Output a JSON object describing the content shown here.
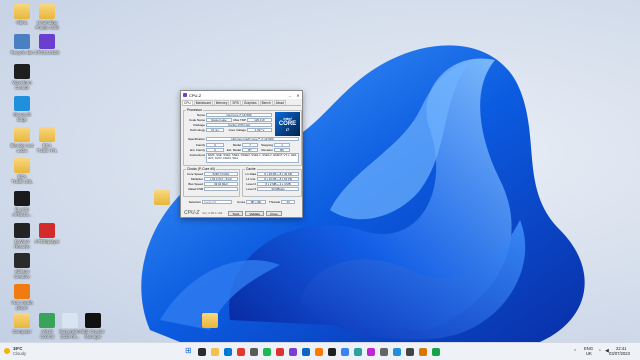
{
  "desktop_icons": [
    {
      "label": "HEAL",
      "color": "#f2c14e",
      "kind": "folder"
    },
    {
      "label": "Unwinding\nProtein Grid",
      "color": "#f2c14e",
      "kind": "folder"
    },
    {
      "label": "Recycle Bin",
      "color": "#4a7fc1",
      "kind": "bin"
    },
    {
      "label": "CRSOUNDS",
      "color": "#6a3fd0",
      "kind": "app"
    },
    {
      "label": "Waveform\nCreator",
      "color": "#1f1f1f",
      "kind": "app"
    },
    {
      "label": "Microsoft\nEdge",
      "color": "#1f8fde",
      "kind": "app"
    },
    {
      "label": "Blender test\naudio",
      "color": "#f2c14e",
      "kind": "folder"
    },
    {
      "label": "BCA\nTUBE HFL",
      "color": "#f2c14e",
      "kind": "folder"
    },
    {
      "label": "BCA\nTUBE UDL",
      "color": "#f2c14e",
      "kind": "folder"
    },
    {
      "label": "BLACK\nAIRBUS...",
      "color": "#1b1b1b",
      "kind": "app"
    },
    {
      "label": "DaVinci\nResolve",
      "color": "#232323",
      "kind": "app"
    },
    {
      "label": "AITEMplayer",
      "color": "#d42a2a",
      "kind": "app"
    },
    {
      "label": "Ableton\nCreative",
      "color": "#2b2b2b",
      "kind": "app"
    },
    {
      "label": "VLC media\nplayer",
      "color": "#f07b10",
      "kind": "app"
    },
    {
      "label": "Computer",
      "color": "#f2c14e",
      "kind": "folder"
    },
    {
      "label": "ASUS\nControl",
      "color": "#3aa35a",
      "kind": "app"
    },
    {
      "label": "Screenshot\n2023-09...",
      "color": "#d9e4f2",
      "kind": "file"
    },
    {
      "label": "Edit Creator\nManager",
      "color": "#111111",
      "kind": "app"
    },
    {
      "label": "",
      "color": "#f2c14e",
      "kind": "folder"
    },
    {
      "label": "",
      "color": "#f2c14e",
      "kind": "folder"
    }
  ],
  "cpuz": {
    "title": "CPU-Z",
    "tabs": [
      "CPU",
      "Mainboard",
      "Memory",
      "SPD",
      "Graphics",
      "Bench",
      "About"
    ],
    "processor_group": "Processor",
    "name_label": "Name",
    "name": "Intel Core i7 13700K",
    "codename_label": "Code Name",
    "codename": "Raptor Lake",
    "maxtdp_label": "Max TDP",
    "maxtdp": "125.0 W",
    "package_label": "Package",
    "package": "Socket 1700 LGA",
    "technology_label": "Technology",
    "technology": "10 nm",
    "corevoltage_label": "Core Voltage",
    "corevoltage": "1.337 V",
    "spec_label": "Specification",
    "spec": "13th Gen Intel® Core™ i7-13700K",
    "family_label": "Family",
    "family": "6",
    "model_label": "Model",
    "model": "7",
    "stepping_label": "Stepping",
    "stepping": "1",
    "extfamily_label": "Ext. Family",
    "extfamily": "6",
    "extmodel_label": "Ext. Model",
    "extmodel": "B7",
    "revision_label": "Revision",
    "revision": "B0",
    "instr_label": "Instructions",
    "instructions": "MMX, SSE, SSE2, SSE3, SSSE3, SSE4.1, SSE4.2, EM64T, VT-x, AES, AVX, AVX2, FMA3, SHA",
    "clocks_group": "Clocks (P-Core #0)",
    "corespeed_label": "Core Speed",
    "corespeed": "5296.73 MHz",
    "multiplier_label": "Multiplier",
    "multiplier": "x 53.0 (8.0 - 53.0)",
    "busspeed_label": "Bus Speed",
    "busspeed": "99.94 MHz",
    "ratedfsb_label": "Rated FSB",
    "ratedfsb": "",
    "cache_group": "Cache",
    "l1d_label": "L1 Data",
    "l1d": "8 x 48 KB + 8 x 32 KB",
    "l1i_label": "L1 Inst.",
    "l1i": "8 x 32 KB + 8 x 64 KB",
    "l2_label": "Level 2",
    "l2": "8 x 2 MB + 2 x 4 MB",
    "l3_label": "Level 3",
    "l3": "30 MBytes",
    "selection_label": "Selection",
    "selection": "Socket #1",
    "cores_label": "Cores",
    "cores": "8P + 8E",
    "threads_label": "Threads",
    "threads": "24",
    "brand": "CPU-Z",
    "version": "Ver. 2.05.1.x64",
    "tools_btn": "Tools",
    "validate_btn": "Validate",
    "close_btn": "Close",
    "intel_brand": "intel",
    "intel_core": "CORE",
    "intel_tier": "i7"
  },
  "taskbar": {
    "weather_temp": "19°C",
    "weather_text": "Cloudy",
    "lang_top": "ENG",
    "lang_bottom": "UK",
    "time": "22:41",
    "date": "03/07/2023",
    "icon_colors": [
      "#1f6fd1",
      "#2c2c2c",
      "#f2c14e",
      "#0078d4",
      "#e23b2e",
      "#5a5a5a",
      "#1db954",
      "#d33",
      "#7a3fd0",
      "#0a66c2",
      "#ff7a00",
      "#222",
      "#3b82f6",
      "#2aa1a1",
      "#c026d3",
      "#666",
      "#1f8fde",
      "#444",
      "#d97706",
      "#16a34a"
    ]
  }
}
